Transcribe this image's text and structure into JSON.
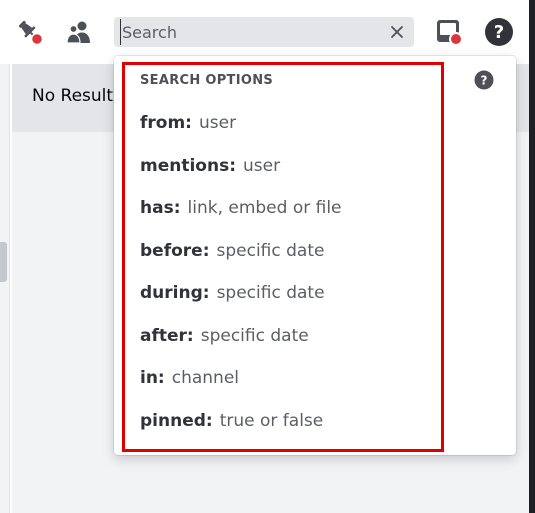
{
  "toolbar": {
    "search_placeholder": "Search",
    "icons": [
      "pin-icon",
      "members-icon",
      "inbox-icon",
      "help-icon"
    ]
  },
  "results": {
    "no_results_text": "No Result"
  },
  "search_options": {
    "header": "SEARCH OPTIONS",
    "options": [
      {
        "key": "from:",
        "value": "user"
      },
      {
        "key": "mentions:",
        "value": "user"
      },
      {
        "key": "has:",
        "value": "link, embed or file"
      },
      {
        "key": "before:",
        "value": "specific date"
      },
      {
        "key": "during:",
        "value": "specific date"
      },
      {
        "key": "after:",
        "value": "specific date"
      },
      {
        "key": "in:",
        "value": "channel"
      },
      {
        "key": "pinned:",
        "value": "true or false"
      }
    ]
  },
  "colors": {
    "highlight_border": "#e00000",
    "notification_dot": "#da373c",
    "icon": "#4e5058"
  }
}
